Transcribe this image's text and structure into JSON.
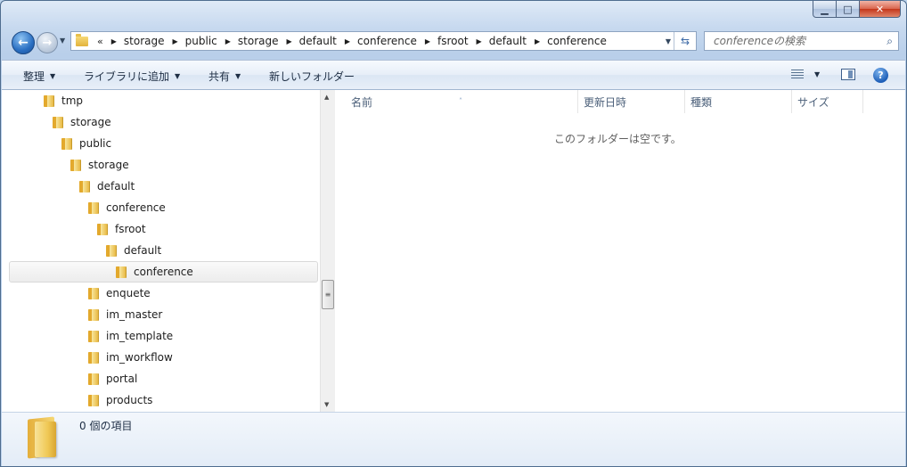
{
  "window": {
    "caption": {
      "minimize": "▁",
      "maximize": "□",
      "close": "✕"
    }
  },
  "address": {
    "overflow": "«",
    "breadcrumbs": [
      "storage",
      "public",
      "storage",
      "default",
      "conference",
      "fsroot",
      "default",
      "conference"
    ],
    "separator": "▶",
    "dropdown": "▼",
    "refresh": "⇆"
  },
  "search": {
    "placeholder": "conferenceの検索"
  },
  "toolbar": {
    "organize": "整理",
    "add_to_library": "ライブラリに追加",
    "share": "共有",
    "new_folder": "新しいフォルダー",
    "dropdown": "▼",
    "help": "?"
  },
  "nav_tree": [
    {
      "label": "tmp",
      "level": 0,
      "selected": false
    },
    {
      "label": "storage",
      "level": 1,
      "selected": false
    },
    {
      "label": "public",
      "level": 2,
      "selected": false
    },
    {
      "label": "storage",
      "level": 3,
      "selected": false
    },
    {
      "label": "default",
      "level": 4,
      "selected": false
    },
    {
      "label": "conference",
      "level": 5,
      "selected": false
    },
    {
      "label": "fsroot",
      "level": 6,
      "selected": false
    },
    {
      "label": "default",
      "level": 7,
      "selected": false
    },
    {
      "label": "conference",
      "level": 8,
      "selected": true
    },
    {
      "label": "enquete",
      "level": 5,
      "selected": false
    },
    {
      "label": "im_master",
      "level": 5,
      "selected": false
    },
    {
      "label": "im_template",
      "level": 5,
      "selected": false
    },
    {
      "label": "im_workflow",
      "level": 5,
      "selected": false
    },
    {
      "label": "portal",
      "level": 5,
      "selected": false
    },
    {
      "label": "products",
      "level": 5,
      "selected": false
    }
  ],
  "file_list": {
    "columns": [
      "名前",
      "更新日時",
      "種類",
      "サイズ"
    ],
    "sort_indicator": "˄",
    "empty_message": "このフォルダーは空です。"
  },
  "details": {
    "item_count": "0 個の項目"
  }
}
